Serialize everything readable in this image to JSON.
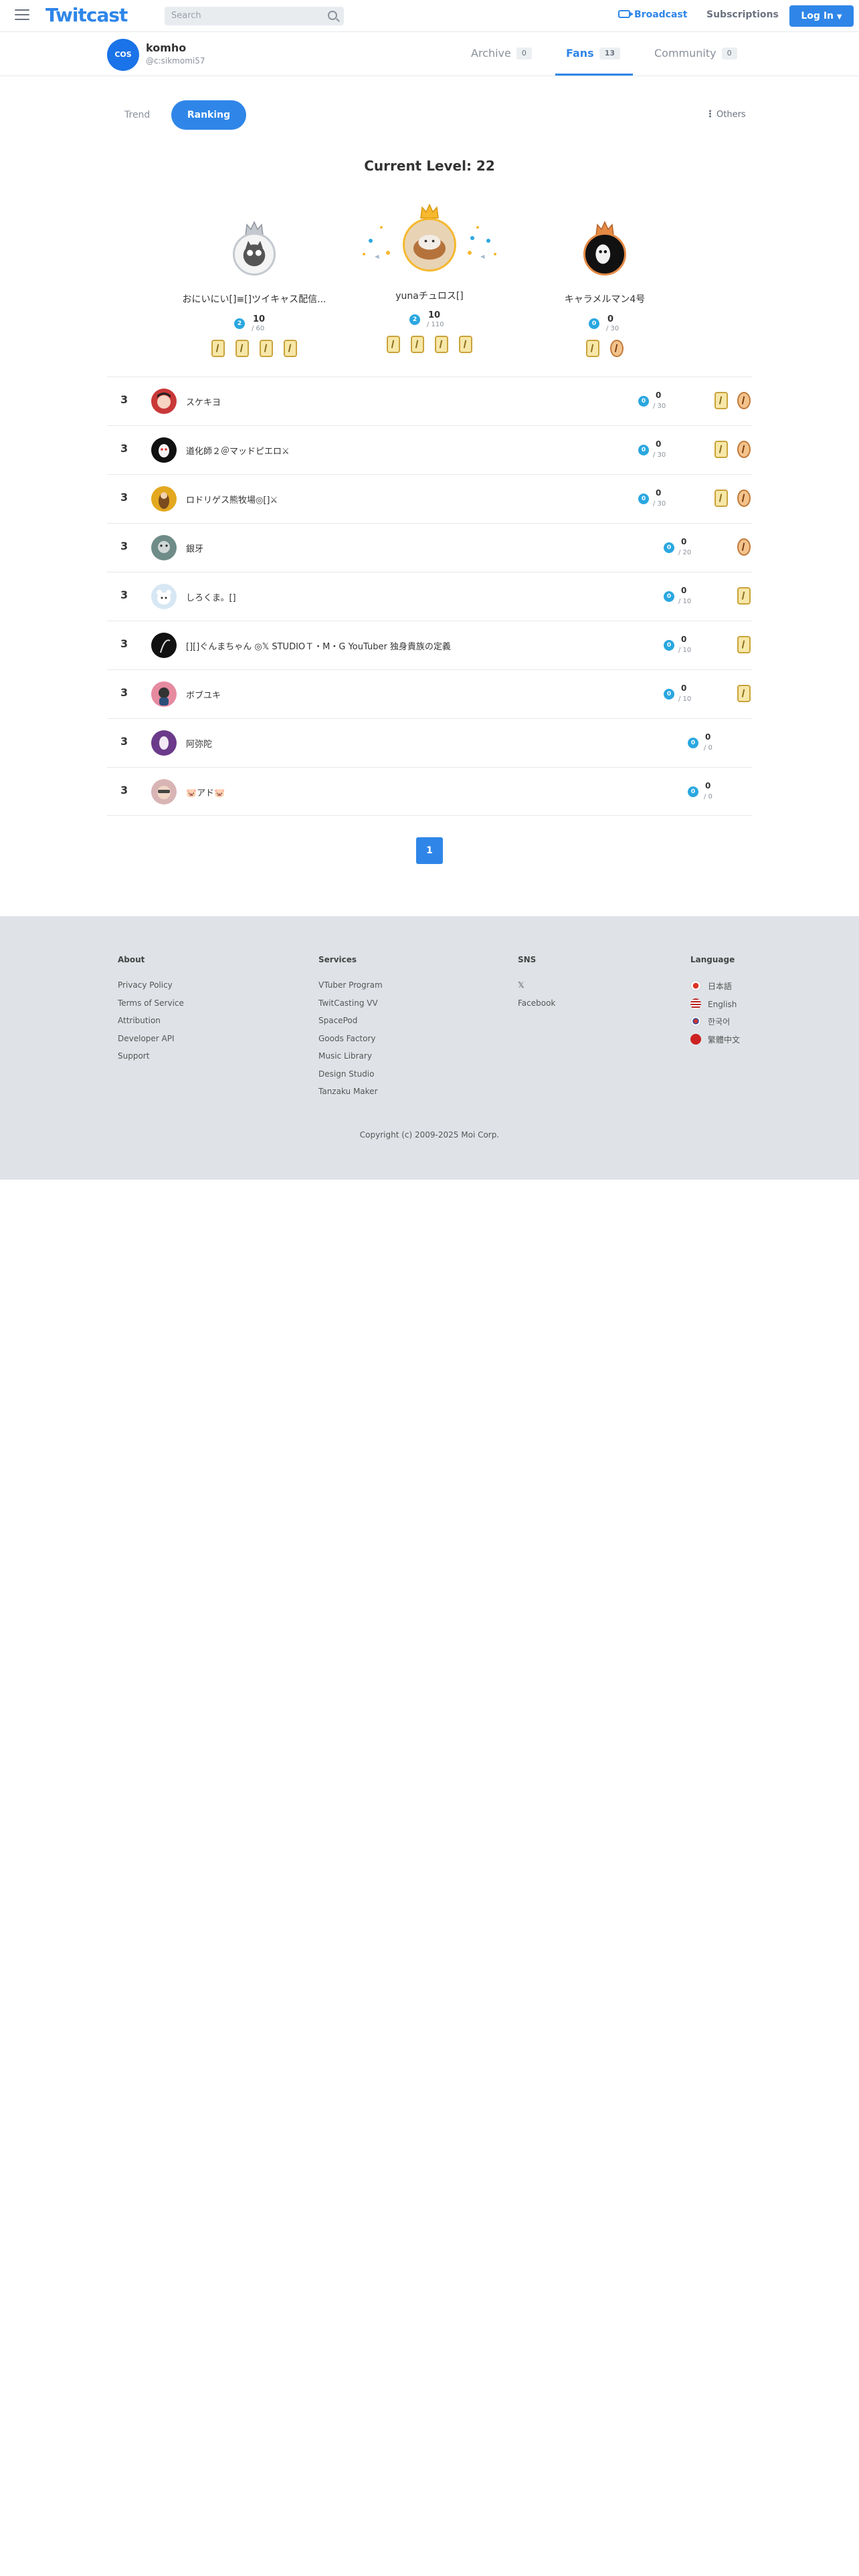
{
  "header": {
    "logo": "Twitcast",
    "search_placeholder": "Search",
    "broadcast_label": "Broadcast",
    "subscriptions_label": "Subscriptions",
    "login_label": "Log In",
    "accent_color": "#2f86e8"
  },
  "profile": {
    "avatar_text": "COS",
    "name": "komho",
    "handle": "@c:sikmomi57",
    "tabs": [
      {
        "label": "Archive",
        "count": "0"
      },
      {
        "label": "Fans",
        "count": "13"
      },
      {
        "label": "Community",
        "count": "0"
      }
    ],
    "active_tab": "Fans"
  },
  "subtabs": {
    "trend": "Trend",
    "ranking": "Ranking",
    "others": "Others"
  },
  "level_title": "Current Level: 22",
  "podium": [
    {
      "place": "second",
      "name": "おにいにい[]≡[]ツイキャス配信...",
      "level_badge": "2",
      "value": "10",
      "max": "/ 60",
      "items": [
        "item-card",
        "item-card",
        "item-card",
        "item-card"
      ]
    },
    {
      "place": "first",
      "name": "yunaチュロス[]",
      "level_badge": "2",
      "value": "10",
      "max": "/ 110",
      "items": [
        "item-card",
        "item-card",
        "item-card",
        "item-card"
      ]
    },
    {
      "place": "third",
      "name": "キャラメルマン4号",
      "level_badge": "0",
      "value": "0",
      "max": "/ 30",
      "items": [
        "item-card",
        "item-dragon"
      ]
    }
  ],
  "ranking": [
    {
      "rank": "3",
      "name": "スケキヨ",
      "level_badge": "0",
      "value": "0",
      "max": "/ 30",
      "items": [
        "item-card",
        "item-dragon"
      ]
    },
    {
      "rank": "3",
      "name": "道化師２＠マッドピエロ⚔",
      "level_badge": "0",
      "value": "0",
      "max": "/ 30",
      "items": [
        "item-card",
        "item-dragon"
      ]
    },
    {
      "rank": "3",
      "name": "ロドリゲス熊牧場◎[]⚔",
      "level_badge": "0",
      "value": "0",
      "max": "/ 30",
      "items": [
        "item-card",
        "item-dragon"
      ]
    },
    {
      "rank": "3",
      "name": "銀牙",
      "level_badge": "0",
      "value": "0",
      "max": "/ 20",
      "items": [
        "item-dragon"
      ]
    },
    {
      "rank": "3",
      "name": "しろくま。[]",
      "level_badge": "0",
      "value": "0",
      "max": "/ 10",
      "items": [
        "item-card"
      ]
    },
    {
      "rank": "3",
      "name": "[][]ぐんまちゃん ◎𝕏 STUDIOＴ・M・G YouTuber 独身貴族の定義",
      "level_badge": "0",
      "value": "0",
      "max": "/ 10",
      "items": [
        "item-card"
      ]
    },
    {
      "rank": "3",
      "name": "ボブユキ",
      "level_badge": "0",
      "value": "0",
      "max": "/ 10",
      "items": [
        "item-card"
      ]
    },
    {
      "rank": "3",
      "name": "阿弥陀",
      "level_badge": "0",
      "value": "0",
      "max": "/ 0",
      "items": []
    },
    {
      "rank": "3",
      "name": "🐷アド🐷",
      "level_badge": "0",
      "value": "0",
      "max": "/ 0",
      "items": []
    }
  ],
  "pagination": {
    "current": "1"
  },
  "footer": {
    "about": {
      "title": "About",
      "links": [
        "Privacy Policy",
        "Terms of Service",
        "Attribution",
        "Developer API",
        "Support"
      ]
    },
    "services": {
      "title": "Services",
      "links": [
        "VTuber Program",
        "TwitCasting VV",
        "SpacePod",
        "Goods Factory",
        "Music Library",
        "Design Studio",
        "Tanzaku Maker"
      ]
    },
    "sns": {
      "title": "SNS",
      "links": [
        "𝕏",
        "Facebook"
      ]
    },
    "language": {
      "title": "Language",
      "links": [
        "日本語",
        "English",
        "한국어",
        "繁體中文"
      ]
    },
    "copyright": "Copyright (c) 2009-2025 Moi Corp."
  }
}
